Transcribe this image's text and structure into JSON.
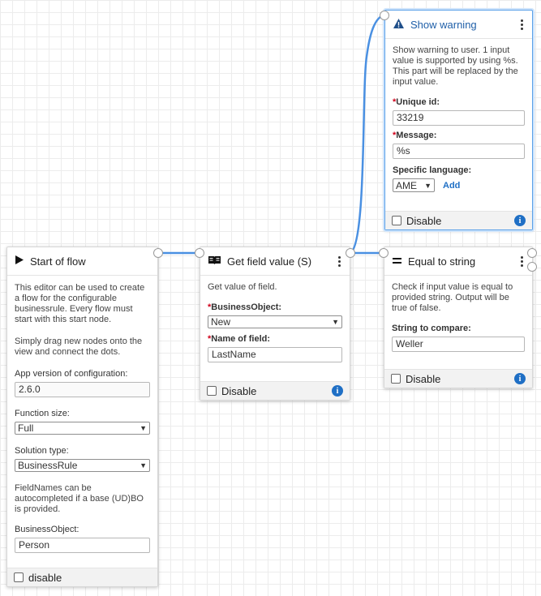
{
  "colors": {
    "wire": "#4a90e2",
    "accent": "#1f6fc5",
    "required": "#d0021b",
    "selected_border": "#5aa0e8"
  },
  "start_node": {
    "icon": "play-icon",
    "title": "Start of flow",
    "description1": "This editor can be used to create a flow for the configurable businessrule. Every flow must start with this start node.",
    "description2": "Simply drag new nodes onto the view and connect the dots.",
    "app_version_label": "App version of configuration:",
    "app_version_value": "2.6.0",
    "function_size_label": "Function size:",
    "function_size_value": "Full",
    "solution_type_label": "Solution type:",
    "solution_type_value": "BusinessRule",
    "fieldnames_note": "FieldNames can be autocompleted if a base (UD)BO is provided.",
    "bo_label": "BusinessObject:",
    "bo_value": "Person",
    "disable_label": "disable"
  },
  "get_field_node": {
    "icon": "book-icon",
    "title": "Get field value (S)",
    "description": "Get value of field.",
    "bo_label": "BusinessObject:",
    "bo_value": "New",
    "field_name_label": "Name of field:",
    "field_name_value": "LastName",
    "disable_label": "Disable",
    "info_glyph": "i"
  },
  "equal_node": {
    "icon": "equals-icon",
    "title": "Equal to string",
    "description": "Check if input value is equal to provided string. Output will be true of false.",
    "compare_label": "String to compare:",
    "compare_value": "Weller",
    "disable_label": "Disable",
    "info_glyph": "i"
  },
  "warning_node": {
    "icon": "warning-icon",
    "title": "Show warning",
    "description": "Show warning to user. 1 input value is supported by using %s. This part will be replaced by the input value.",
    "unique_id_label": "Unique id:",
    "unique_id_value": "33219",
    "message_label": "Message:",
    "message_value": "%s",
    "language_label": "Specific language:",
    "language_value": "AME",
    "add_label": "Add",
    "disable_label": "Disable",
    "info_glyph": "i"
  },
  "required_mark": "*"
}
